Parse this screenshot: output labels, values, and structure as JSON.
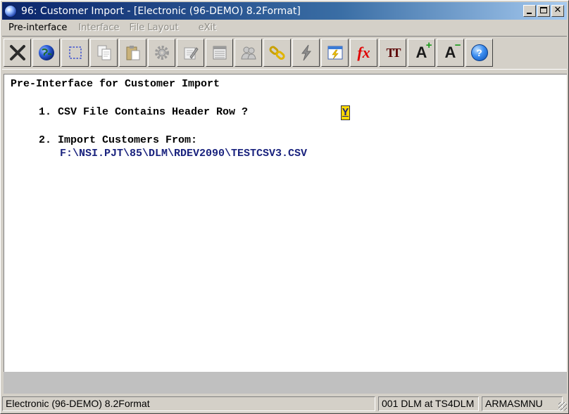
{
  "window": {
    "title": "96: Customer Import - [Electronic (96-DEMO) 8.2Format]"
  },
  "menu": {
    "items": [
      {
        "label": "Pre-interface",
        "enabled": true
      },
      {
        "label": "Interface",
        "enabled": false
      },
      {
        "label": "File Layout",
        "enabled": false
      },
      {
        "label": "eXit",
        "enabled": false
      }
    ]
  },
  "toolbar": {
    "buttons": [
      {
        "icon": "close-x-icon"
      },
      {
        "icon": "globe-icon"
      },
      {
        "icon": "selection-icon"
      },
      {
        "icon": "copy-icon"
      },
      {
        "icon": "paste-icon"
      },
      {
        "icon": "gear-icon"
      },
      {
        "icon": "edit-icon"
      },
      {
        "icon": "list-icon"
      },
      {
        "icon": "users-icon"
      },
      {
        "icon": "link-icon"
      },
      {
        "icon": "lightning-icon"
      },
      {
        "icon": "calendar-icon"
      },
      {
        "icon": "function-icon"
      },
      {
        "icon": "text-size-icon"
      },
      {
        "icon": "font-increase-icon"
      },
      {
        "icon": "font-decrease-icon"
      },
      {
        "icon": "help-icon"
      }
    ],
    "fx_label": "fx",
    "tt_label": "TT",
    "a_label": "A",
    "plus_label": "+",
    "minus_label": "−",
    "help_label": "?"
  },
  "content": {
    "header": "Pre-Interface for Customer Import",
    "q1": "1. CSV File Contains Header Row ?",
    "q1_value": "Y",
    "q2": "2. Import Customers From:",
    "path": "F:\\NSI.PJT\\85\\DLM\\RDEV2090\\TESTCSV3.CSV"
  },
  "status": {
    "panel1": "Electronic (96-DEMO) 8.2Format",
    "panel2": "001 DLM at TS4DLM",
    "panel3": "ARMASMNU"
  },
  "colors": {
    "title_bar": "#0a246a",
    "field_highlight": "#ffd800",
    "path_text": "#1a237e"
  }
}
